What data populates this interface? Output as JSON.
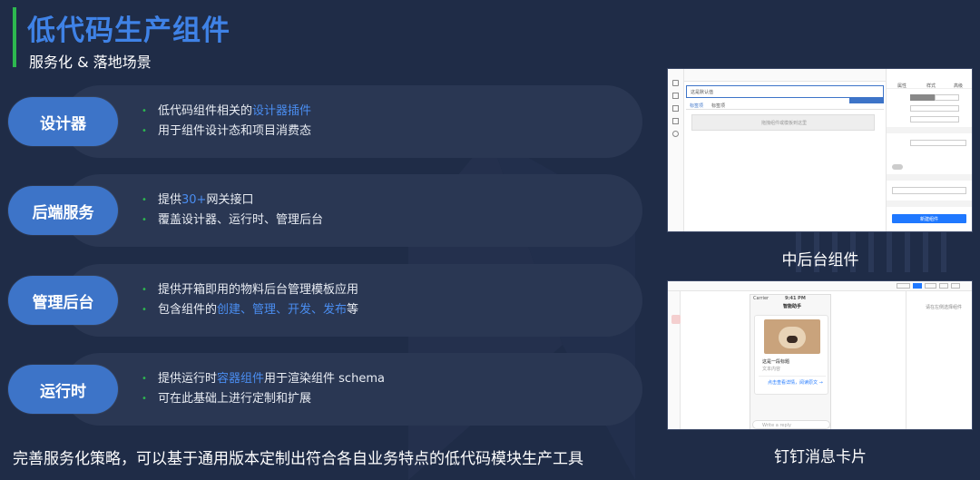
{
  "header": {
    "title": "低代码生产组件",
    "subtitle": "服务化 & 落地场景"
  },
  "rows": [
    {
      "label": "设计器",
      "bullets": [
        {
          "parts": [
            {
              "t": "低代码组件相关的",
              "hl": false
            },
            {
              "t": "设计器插件",
              "hl": true
            }
          ]
        },
        {
          "parts": [
            {
              "t": "用于组件设计态和项目消费态",
              "hl": false
            }
          ]
        }
      ]
    },
    {
      "label": "后端服务",
      "bullets": [
        {
          "parts": [
            {
              "t": "提供 ",
              "hl": false
            },
            {
              "t": "30+",
              "hl": true
            },
            {
              "t": " 网关接口",
              "hl": false
            }
          ]
        },
        {
          "parts": [
            {
              "t": "覆盖设计器、运行时、管理后台",
              "hl": false
            }
          ]
        }
      ]
    },
    {
      "label": "管理后台",
      "bullets": [
        {
          "parts": [
            {
              "t": "提供开箱即用的物料后台管理模板应用",
              "hl": false
            }
          ]
        },
        {
          "parts": [
            {
              "t": "包含组件的",
              "hl": false
            },
            {
              "t": "创建、管理、开发、发布",
              "hl": true
            },
            {
              "t": "等",
              "hl": false
            }
          ]
        }
      ]
    },
    {
      "label": "运行时",
      "bullets": [
        {
          "parts": [
            {
              "t": "提供运行时",
              "hl": false
            },
            {
              "t": "容器组件",
              "hl": true
            },
            {
              "t": "用于渲染组件 schema",
              "hl": false
            }
          ]
        },
        {
          "parts": [
            {
              "t": "可在此基础上进行定制和扩展",
              "hl": false
            }
          ]
        }
      ]
    }
  ],
  "footer": {
    "text": "完善服务化策略，可以基于通用版本定制出符合各自业务特点的低代码模块生产工具"
  },
  "screenshots": {
    "top_caption": "中后台组件",
    "bottom_caption": "钉钉消息卡片",
    "top_ui": {
      "input_placeholder": "这是默认值",
      "tab_1": "标签项",
      "tab_2": "标签项",
      "drop_hint": "拖拽组件或模板到这里",
      "panel_tabs": [
        "属性",
        "样式",
        "高级"
      ],
      "panel_button": "新建组件"
    },
    "bottom_ui": {
      "phone_status": "Carrier",
      "phone_time": "9:41 PM",
      "chat_title": "智能助手",
      "card_title": "这是一段标题",
      "card_subtitle": "文本内容",
      "card_link": "点击查看详情，阅读原文 →",
      "composer_placeholder": "Write a reply",
      "side_hint": "请在左侧选择组件"
    }
  },
  "colors": {
    "background": "#1f2c47",
    "accent_blue": "#3f82e6",
    "pill_blue": "#3d74c8",
    "highlight": "#4a8df0",
    "green": "#2db84f"
  }
}
